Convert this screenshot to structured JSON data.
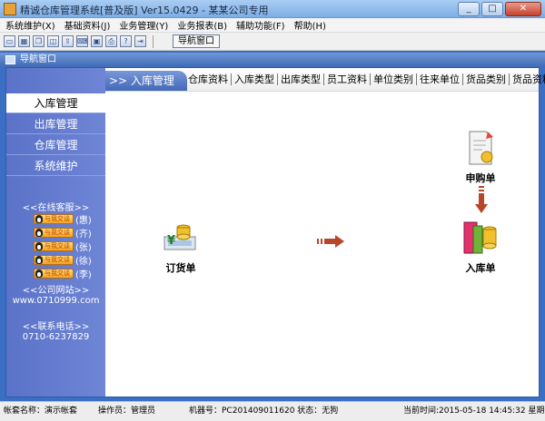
{
  "window": {
    "title": "精诚仓库管理系统[普及版] Ver15.0429 - 某某公司专用",
    "buttons": {
      "minimize": "_",
      "maximize": "□",
      "close": "✕"
    }
  },
  "menubar": [
    "系统维护(X)",
    "基础资料(J)",
    "业务管理(Y)",
    "业务报表(B)",
    "辅助功能(F)",
    "帮助(H)"
  ],
  "toolbar": {
    "icons": [
      "window-icon",
      "grid-icon",
      "copy-icon",
      "print-preview-icon",
      "export-icon",
      "keyboard-icon",
      "save-icon",
      "print-icon",
      "help-icon",
      "exit-icon"
    ],
    "nav_window_label": "导航窗口"
  },
  "nav_header": {
    "title": "导航窗口"
  },
  "sidebar": {
    "items": [
      "入库管理",
      "出库管理",
      "仓库管理",
      "系统维护"
    ],
    "active_index": 0,
    "online_service_title": "<<在线客服>>",
    "qq_badge_text": "与我交谈",
    "service_agents": [
      "(惠)",
      "(齐)",
      "(张)",
      "(徐)",
      "(李)"
    ],
    "website_title": "<<公司网站>>",
    "website_url": "www.0710999.com",
    "phone_title": "<<联系电话>>",
    "phone": "0710-6237829"
  },
  "tabbar": {
    "active_label": ">> 入库管理",
    "links": [
      "仓库资料",
      "入库类型",
      "出库类型",
      "员工资料",
      "单位类别",
      "往来单位",
      "货品类别",
      "货品资料"
    ]
  },
  "flow": {
    "order": "订货单",
    "purchase_request": "申购单",
    "stock_in": "入库单"
  },
  "statusbar": {
    "account": "帐套名称：演示帐套",
    "operator": "操作员：管理员",
    "machine": "机器号：PC201409011620 状态：无狗",
    "time": "当前时间:2015-05-18 14:45:32 星期一"
  },
  "colors": {
    "sidebar": "#6f86d6",
    "tab_active": "#4468b8",
    "arrow": "#b8462a"
  }
}
